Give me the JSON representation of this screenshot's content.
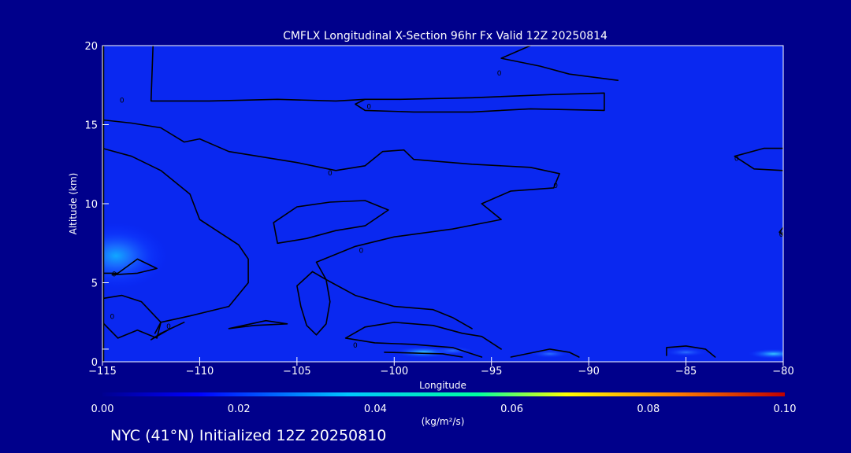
{
  "chart_data": {
    "type": "heatmap",
    "title": "CMFLX Longitudinal X-Section 96hr  Fx Valid 12Z 20250814",
    "xlabel": "Longitude",
    "ylabel": "Altitude (km)",
    "xlim": [
      -115,
      -80
    ],
    "ylim": [
      0,
      20
    ],
    "x_ticks": [
      -115,
      -110,
      -105,
      -100,
      -95,
      -90,
      -85,
      -80
    ],
    "x_tick_labels": [
      "−115",
      "−110",
      "−105",
      "−100",
      "−95",
      "−90",
      "−85",
      "−80"
    ],
    "y_ticks": [
      0,
      5,
      10,
      15,
      20
    ],
    "y_tick_labels": [
      "0",
      "5",
      "10",
      "15",
      "20"
    ],
    "contour_level": 0,
    "contour_label": "0",
    "colorbar": {
      "label": "(kg/m²/s)",
      "min": 0.0,
      "max": 0.1,
      "ticks": [
        0.0,
        0.02,
        0.04,
        0.06,
        0.08,
        0.1
      ],
      "tick_labels": [
        "0.00",
        "0.02",
        "0.04",
        "0.06",
        "0.08",
        "0.10"
      ],
      "colors": [
        "#0000a0",
        "#0000ff",
        "#00c8ff",
        "#00ffa0",
        "#ffff00",
        "#ff8000",
        "#c00000"
      ]
    },
    "flux_maxima": [
      {
        "lon": -114.3,
        "alt_km": 6.7,
        "value": 0.03
      },
      {
        "lon": -98.5,
        "alt_km": 0.6,
        "value": 0.022
      },
      {
        "lon": -97.0,
        "alt_km": 0.7,
        "value": 0.01
      },
      {
        "lon": -92.0,
        "alt_km": 0.5,
        "value": 0.008
      },
      {
        "lon": -85.0,
        "alt_km": 0.6,
        "value": 0.01
      },
      {
        "lon": -80.5,
        "alt_km": 0.5,
        "value": 0.016
      }
    ],
    "contours": [
      {
        "points": [
          [
            -112.4,
            20
          ],
          [
            -112.5,
            16.5
          ],
          [
            -109.5,
            16.5
          ],
          [
            -106,
            16.6
          ],
          [
            -103,
            16.5
          ],
          [
            -101.5,
            16.6
          ],
          [
            -99.7,
            16.6
          ]
        ]
      },
      {
        "points": [
          [
            -101.5,
            16.6
          ],
          [
            -102,
            16.3
          ],
          [
            -101.5,
            15.9
          ],
          [
            -99,
            15.8
          ],
          [
            -96,
            15.8
          ],
          [
            -93,
            16
          ],
          [
            -89.2,
            15.9
          ],
          [
            -89.2,
            17
          ],
          [
            -92,
            16.9
          ],
          [
            -96,
            16.7
          ],
          [
            -99.7,
            16.6
          ]
        ]
      },
      {
        "points": [
          [
            -115,
            15.3
          ],
          [
            -113.5,
            15.1
          ],
          [
            -112,
            14.8
          ],
          [
            -110.8,
            13.9
          ],
          [
            -110,
            14.1
          ],
          [
            -108.5,
            13.3
          ],
          [
            -105,
            12.6
          ],
          [
            -103,
            12.1
          ],
          [
            -101.5,
            12.4
          ],
          [
            -100.6,
            13.3
          ],
          [
            -99.5,
            13.4
          ],
          [
            -99,
            12.8
          ],
          [
            -96,
            12.5
          ],
          [
            -93,
            12.3
          ],
          [
            -91.5,
            11.9
          ],
          [
            -91.8,
            11
          ],
          [
            -94,
            10.8
          ],
          [
            -95.5,
            10
          ]
        ]
      },
      {
        "points": [
          [
            -95.5,
            10
          ],
          [
            -94.5,
            9
          ],
          [
            -97,
            8.4
          ],
          [
            -100,
            7.9
          ],
          [
            -102,
            7.3
          ],
          [
            -104,
            6.3
          ],
          [
            -103.5,
            5.2
          ],
          [
            -102,
            4.2
          ],
          [
            -100,
            3.5
          ],
          [
            -98,
            3.3
          ],
          [
            -97,
            2.8
          ],
          [
            -96,
            2.1
          ]
        ]
      },
      {
        "points": [
          [
            -115,
            13.5
          ],
          [
            -113.5,
            13
          ],
          [
            -112,
            12.1
          ],
          [
            -110.5,
            10.6
          ],
          [
            -110,
            9
          ],
          [
            -108,
            7.4
          ],
          [
            -107.5,
            6.5
          ],
          [
            -107.5,
            5
          ],
          [
            -108.5,
            3.5
          ],
          [
            -110.5,
            2.9
          ],
          [
            -112,
            2.5
          ],
          [
            -112.3,
            1.8
          ]
        ]
      },
      {
        "points": [
          [
            -103.3,
            10.1
          ],
          [
            -105,
            9.8
          ],
          [
            -106.2,
            8.8
          ],
          [
            -106,
            7.5
          ],
          [
            -104.5,
            7.8
          ],
          [
            -103,
            8.3
          ],
          [
            -101.5,
            8.6
          ],
          [
            -100.3,
            9.6
          ],
          [
            -101.5,
            10.2
          ],
          [
            -103.3,
            10.1
          ]
        ]
      },
      {
        "points": [
          [
            -104.2,
            5.7
          ],
          [
            -105,
            4.8
          ],
          [
            -104.8,
            3.5
          ],
          [
            -104.5,
            2.3
          ],
          [
            -104,
            1.7
          ],
          [
            -103.5,
            2.4
          ],
          [
            -103.3,
            3.8
          ],
          [
            -103.5,
            5.2
          ],
          [
            -104.2,
            5.7
          ]
        ]
      },
      {
        "points": [
          [
            -115,
            4
          ],
          [
            -114,
            4.2
          ],
          [
            -113,
            3.8
          ],
          [
            -112,
            2.5
          ],
          [
            -112.2,
            1.5
          ],
          [
            -113.2,
            2
          ],
          [
            -114.2,
            1.5
          ],
          [
            -115,
            2.5
          ]
        ]
      },
      {
        "points": [
          [
            -115,
            5.6
          ],
          [
            -114.2,
            5.6
          ],
          [
            -113.2,
            6.5
          ],
          [
            -112.2,
            5.9
          ],
          [
            -113.2,
            5.6
          ],
          [
            -114.5,
            5.5
          ]
        ]
      },
      {
        "points": [
          [
            -110.8,
            2.5
          ],
          [
            -111.5,
            2.1
          ],
          [
            -112.5,
            1.4
          ],
          [
            -112,
            1.8
          ],
          [
            -110.8,
            2.5
          ]
        ]
      },
      {
        "points": [
          [
            -108.5,
            2.1
          ],
          [
            -106.6,
            2.6
          ],
          [
            -105.5,
            2.4
          ],
          [
            -107.2,
            2.3
          ],
          [
            -108.5,
            2.1
          ]
        ]
      },
      {
        "points": [
          [
            -101.5,
            2.2
          ],
          [
            -100,
            2.5
          ],
          [
            -98,
            2.3
          ],
          [
            -96.5,
            1.8
          ],
          [
            -95.5,
            1.6
          ],
          [
            -94.5,
            0.8
          ]
        ]
      },
      {
        "points": [
          [
            -101.5,
            2.2
          ],
          [
            -102.5,
            1.5
          ],
          [
            -101,
            1.2
          ],
          [
            -99,
            1.1
          ],
          [
            -97,
            0.9
          ],
          [
            -95.5,
            0.3
          ]
        ]
      },
      {
        "points": [
          [
            -94,
            0.3
          ],
          [
            -92,
            0.8
          ],
          [
            -91,
            0.6
          ],
          [
            -90.5,
            0.3
          ]
        ]
      },
      {
        "points": [
          [
            -86,
            0.4
          ],
          [
            -86,
            0.9
          ],
          [
            -85,
            1
          ],
          [
            -84,
            0.8
          ],
          [
            -83.5,
            0.3
          ]
        ]
      },
      {
        "points": [
          [
            -80,
            13.5
          ],
          [
            -81,
            13.5
          ],
          [
            -82.5,
            13
          ],
          [
            -81.5,
            12.2
          ],
          [
            -80,
            12.1
          ]
        ]
      },
      {
        "points": [
          [
            -80,
            8
          ],
          [
            -80.2,
            8.2
          ],
          [
            -80,
            8.5
          ]
        ]
      },
      {
        "points": [
          [
            -100.5,
            0.6
          ],
          [
            -97.5,
            0.5
          ],
          [
            -96.5,
            0.3
          ]
        ]
      },
      {
        "points": [
          [
            -93,
            20
          ],
          [
            -94.5,
            19.2
          ],
          [
            -92.5,
            18.7
          ],
          [
            -91,
            18.2
          ],
          [
            -88.5,
            17.8
          ]
        ]
      }
    ],
    "contour_labels": [
      {
        "lon": -114,
        "alt_km": 16.6
      },
      {
        "lon": -101.3,
        "alt_km": 16.2
      },
      {
        "lon": -94.6,
        "alt_km": 18.3
      },
      {
        "lon": -103.3,
        "alt_km": 12
      },
      {
        "lon": -91.7,
        "alt_km": 11.2
      },
      {
        "lon": -101.7,
        "alt_km": 7.1
      },
      {
        "lon": -114.4,
        "alt_km": 5.6
      },
      {
        "lon": -114.5,
        "alt_km": 2.9
      },
      {
        "lon": -111.6,
        "alt_km": 2.3
      },
      {
        "lon": -102,
        "alt_km": 1.1
      },
      {
        "lon": -82.4,
        "alt_km": 12.9
      },
      {
        "lon": -80.1,
        "alt_km": 8.1
      }
    ],
    "footer": "NYC (41°N) Initialized 12Z 20250810"
  }
}
